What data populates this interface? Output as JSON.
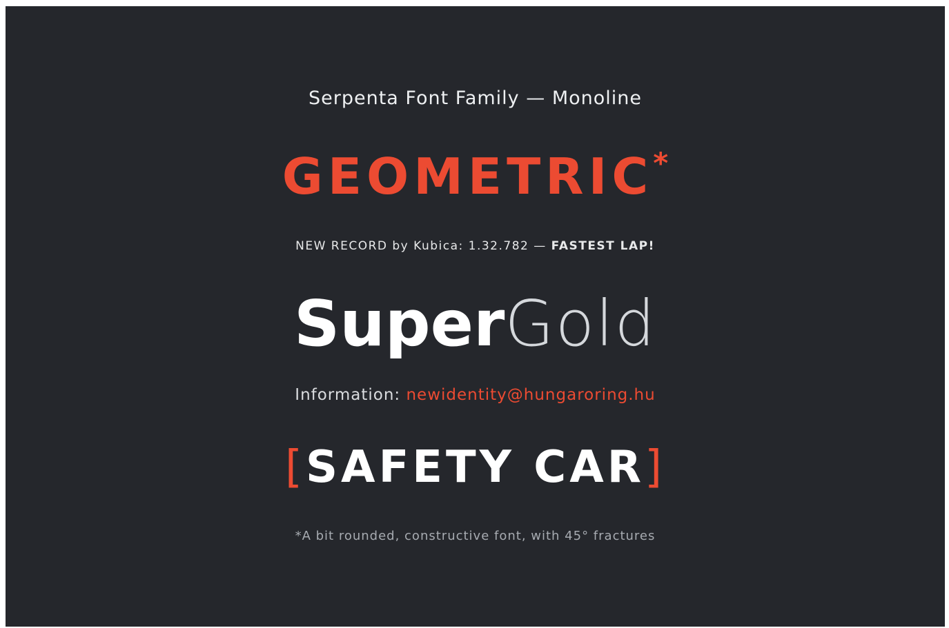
{
  "subtitle": "Serpenta Font Family — Monoline",
  "headline": {
    "word": "GEOMETRIC",
    "asterisk": "*"
  },
  "record": {
    "text": "NEW RECORD by Kubica:  1.32.782 — ",
    "emphasis": "FASTEST LAP!"
  },
  "brand": {
    "bold": "Super",
    "light": "Gold"
  },
  "information": {
    "label": "Information: ",
    "email": "newidentity@hungaroring.hu"
  },
  "badge": {
    "open_bracket": "[",
    "text": "SAFETY CAR",
    "close_bracket": "]"
  },
  "footnote": "*A bit rounded, constructive font, with 45° fractures",
  "colors": {
    "background": "#25272c",
    "accent": "#ec4b32",
    "text": "#ffffff"
  }
}
